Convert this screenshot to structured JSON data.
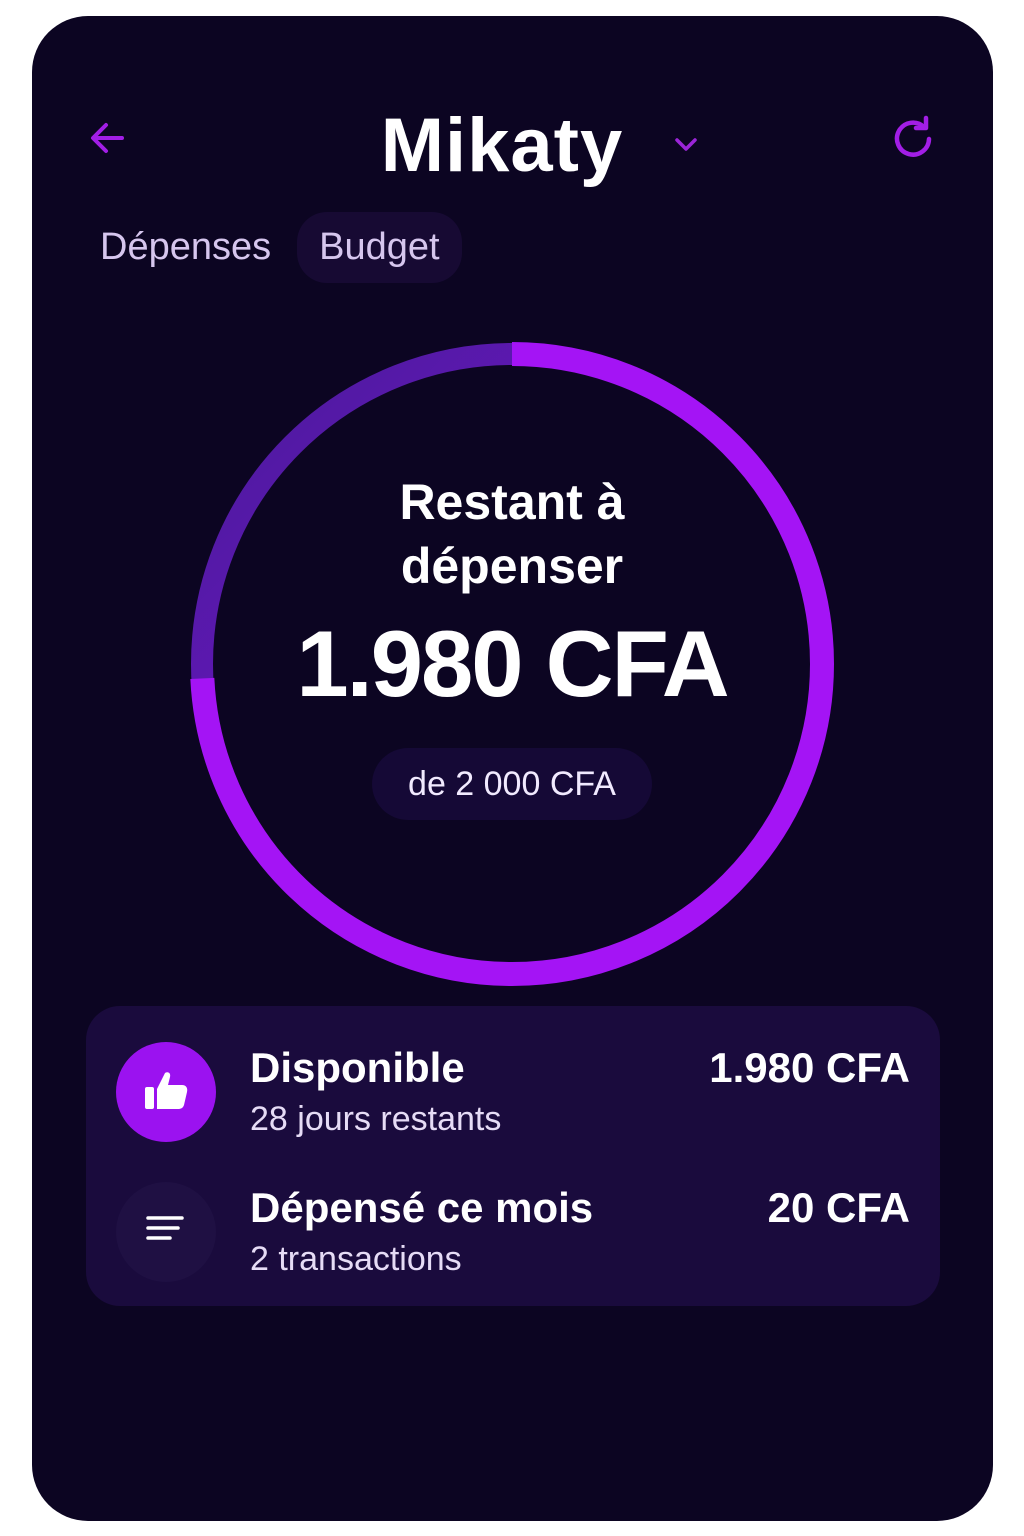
{
  "header": {
    "title": "Mikaty"
  },
  "tabs": [
    {
      "label": "Dépenses",
      "active": false
    },
    {
      "label": "Budget",
      "active": true
    }
  ],
  "budget": {
    "label_line1": "Restant à",
    "label_line2": "dépenser",
    "remaining": "1.980 CFA",
    "total": "de 2 000 CFA",
    "remaining_fraction": 0.99
  },
  "summary": {
    "rows": [
      {
        "title": "Disponible",
        "subtitle": "28 jours restants",
        "amount": "1.980 CFA",
        "icon": "thumbs-up-icon"
      },
      {
        "title": "Dépensé ce mois",
        "subtitle": "2 transactions",
        "amount": "20 CFA",
        "icon": "list-icon"
      }
    ]
  },
  "colors": {
    "background": "#0c0522",
    "accent": "#9b12f0",
    "ring_track": "#3e1a8a",
    "card": "#1a0b3d"
  }
}
